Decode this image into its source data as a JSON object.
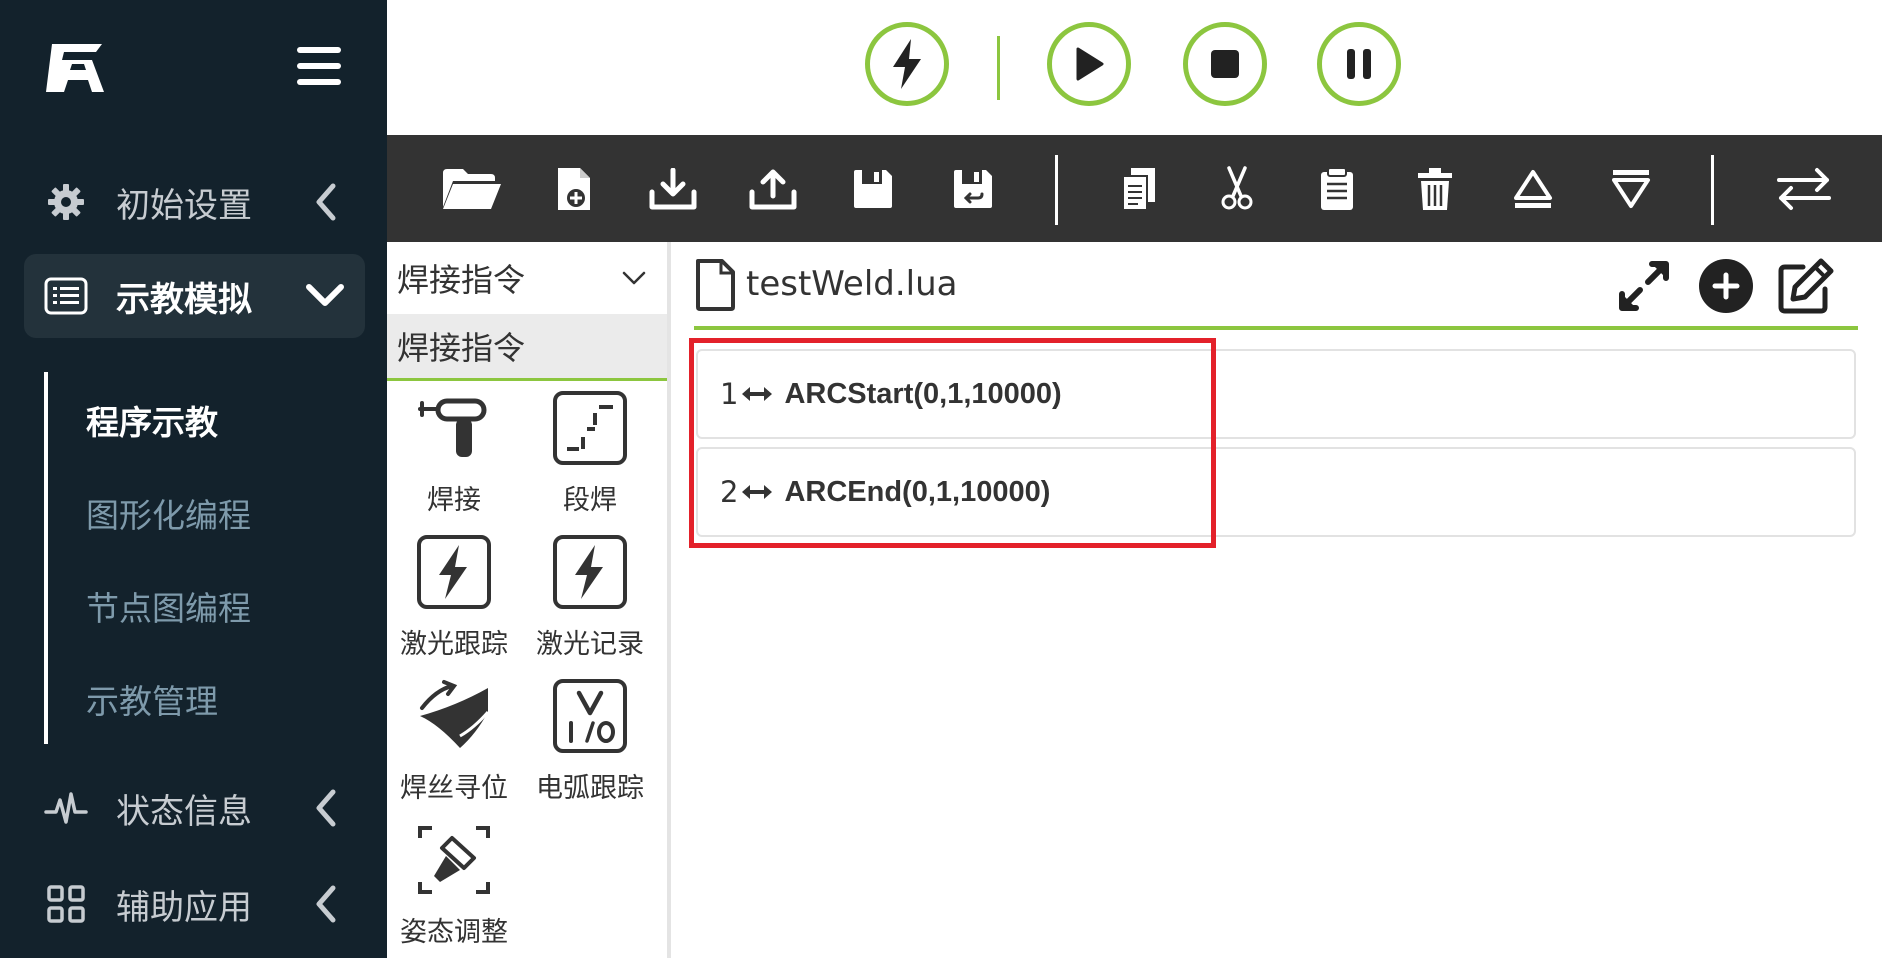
{
  "sidebar": {
    "nav": [
      {
        "label": "初始设置",
        "icon": "gear-icon"
      },
      {
        "label": "示教模拟",
        "icon": "list-icon"
      },
      {
        "label": "状态信息",
        "icon": "pulse-icon"
      },
      {
        "label": "辅助应用",
        "icon": "grid-icon"
      }
    ],
    "subitems": [
      {
        "label": "程序示教"
      },
      {
        "label": "图形化编程"
      },
      {
        "label": "节点图编程"
      },
      {
        "label": "示教管理"
      }
    ]
  },
  "palette": {
    "selected_group": "焊接指令",
    "category": "焊接指令",
    "tools": [
      {
        "label": "焊接",
        "icon": "weld-torch-icon"
      },
      {
        "label": "段焊",
        "icon": "segment-weld-icon"
      },
      {
        "label": "激光跟踪",
        "icon": "laser-track-icon"
      },
      {
        "label": "激光记录",
        "icon": "laser-record-icon"
      },
      {
        "label": "焊丝寻位",
        "icon": "wire-search-icon"
      },
      {
        "label": "电弧跟踪",
        "icon": "arc-track-icon"
      },
      {
        "label": "姿态调整",
        "icon": "posture-adjust-icon"
      }
    ]
  },
  "editor": {
    "file_name": "testWeld.lua",
    "lines": [
      {
        "num": "1",
        "cmd": "ARCStart(0,1,10000)"
      },
      {
        "num": "2",
        "cmd": "ARCEnd(0,1,10000)"
      }
    ]
  },
  "colors": {
    "sidebar_bg": "#13222c",
    "accent_green": "#8cc63f",
    "toolbar_bg": "#333333",
    "highlight_red": "#e3212a"
  }
}
